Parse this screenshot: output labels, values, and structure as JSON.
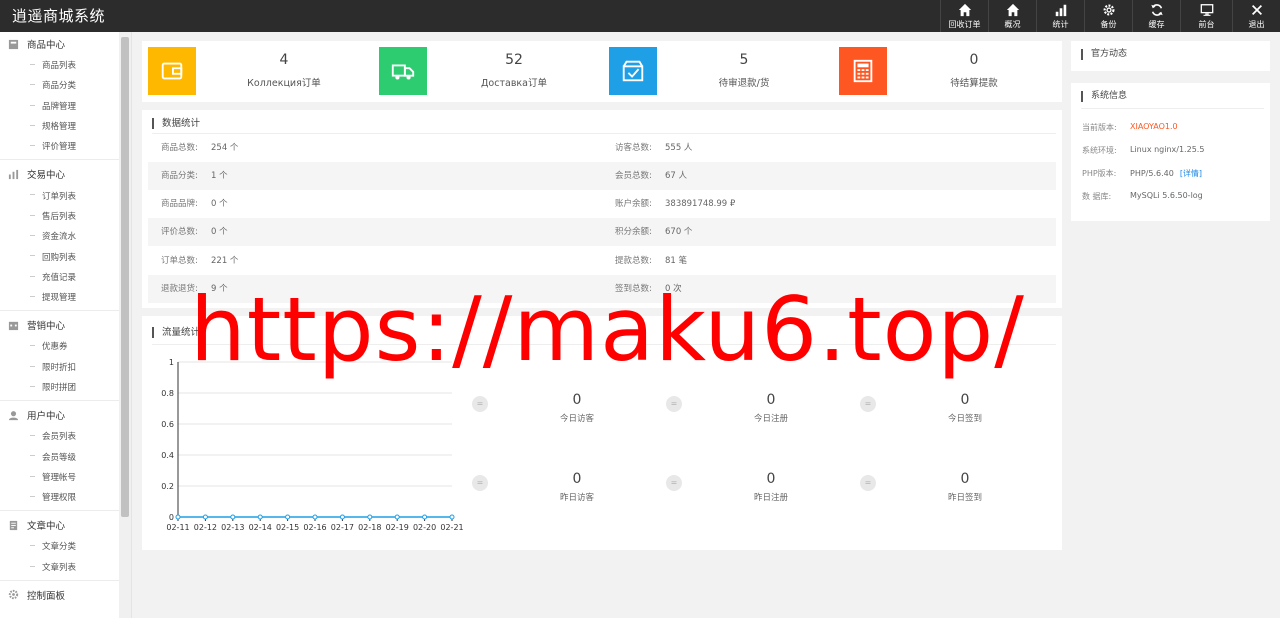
{
  "app": {
    "title": "逍遥商城系统"
  },
  "topnav": [
    {
      "label": "回收订单",
      "icon": "home-icon"
    },
    {
      "label": "概况",
      "icon": "home-icon"
    },
    {
      "label": "统计",
      "icon": "bar-chart-icon"
    },
    {
      "label": "备份",
      "icon": "gear-icon"
    },
    {
      "label": "缓存",
      "icon": "refresh-icon"
    },
    {
      "label": "前台",
      "icon": "monitor-icon"
    },
    {
      "label": "退出",
      "icon": "close-icon"
    }
  ],
  "sidebar": {
    "groups": [
      {
        "title": "商品中心",
        "icon": "product-icon",
        "items": [
          "商品列表",
          "商品分类",
          "品牌管理",
          "规格管理",
          "评价管理"
        ]
      },
      {
        "title": "交易中心",
        "icon": "trade-chart-icon",
        "items": [
          "订单列表",
          "售后列表",
          "资金流水",
          "回购列表",
          "充值记录",
          "提现管理"
        ]
      },
      {
        "title": "营销中心",
        "icon": "marketing-icon",
        "items": [
          "优惠券",
          "限时折扣",
          "限时拼团"
        ]
      },
      {
        "title": "用户中心",
        "icon": "user-icon",
        "items": [
          "会员列表",
          "会员等级",
          "管理帐号",
          "管理权限"
        ]
      },
      {
        "title": "文章中心",
        "icon": "article-icon",
        "items": [
          "文章分类",
          "文章列表"
        ]
      },
      {
        "title": "控制面板",
        "icon": "settings-icon",
        "items": []
      }
    ]
  },
  "stats": [
    {
      "value": "4",
      "label": "Коллекция订单",
      "color": "#ffb800",
      "icon": "wallet-icon"
    },
    {
      "value": "52",
      "label": "Доставка订单",
      "color": "#2ecc71",
      "icon": "truck-icon"
    },
    {
      "value": "5",
      "label": "待审退款/货",
      "color": "#1e9fe6",
      "icon": "checkbox-icon"
    },
    {
      "value": "0",
      "label": "待结算提款",
      "color": "#ff5722",
      "icon": "calculator-icon"
    }
  ],
  "data_stats": {
    "title": "数据统计",
    "rows": [
      {
        "left_key": "商品总数:",
        "left_val": "254 个",
        "right_key": "访客总数:",
        "right_val": "555 人"
      },
      {
        "left_key": "商品分类:",
        "left_val": "1 个",
        "right_key": "会员总数:",
        "right_val": "67 人"
      },
      {
        "left_key": "商品品牌:",
        "left_val": "0 个",
        "right_key": "账户余额:",
        "right_val": "383891748.99 ₽"
      },
      {
        "left_key": "评价总数:",
        "left_val": "0 个",
        "right_key": "积分余额:",
        "right_val": "670 个"
      },
      {
        "left_key": "订单总数:",
        "left_val": "221 个",
        "right_key": "提款总数:",
        "right_val": "81 笔"
      },
      {
        "left_key": "退款退货:",
        "left_val": "9 个",
        "right_key": "签到总数:",
        "right_val": "0 次"
      }
    ]
  },
  "traffic": {
    "title": "流量统计",
    "today": [
      {
        "value": "0",
        "label": "今日访客"
      },
      {
        "value": "0",
        "label": "今日注册"
      },
      {
        "value": "0",
        "label": "今日签到"
      }
    ],
    "yesterday": [
      {
        "value": "0",
        "label": "昨日访客"
      },
      {
        "value": "0",
        "label": "昨日注册"
      },
      {
        "value": "0",
        "label": "昨日签到"
      }
    ],
    "badge": "="
  },
  "chart_data": {
    "type": "line",
    "x": [
      "02-11",
      "02-12",
      "02-13",
      "02-14",
      "02-15",
      "02-16",
      "02-17",
      "02-18",
      "02-19",
      "02-20",
      "02-21"
    ],
    "series": [
      {
        "values": [
          0,
          0,
          0,
          0,
          0,
          0,
          0,
          0,
          0,
          0,
          0
        ]
      }
    ],
    "ylim": [
      0,
      1
    ],
    "yticks": [
      "0",
      "0.2",
      "0.4",
      "0.6",
      "0.8",
      "1"
    ],
    "grid": true,
    "line_color": "#1e9fe6"
  },
  "official_news": {
    "title": "官方动态"
  },
  "system_info": {
    "title": "系统信息",
    "rows": [
      {
        "key": "当前版本:",
        "value": "XIAOYAO1.0"
      },
      {
        "key": "系统环境:",
        "value": "Linux nginx/1.25.5"
      },
      {
        "key": "PHP版本:",
        "value": "PHP/5.6.40",
        "link": "[详情]"
      },
      {
        "key": "数 据库:",
        "value": "MySQLi 5.6.50-log"
      }
    ]
  },
  "watermark": "https://maku6.top/"
}
